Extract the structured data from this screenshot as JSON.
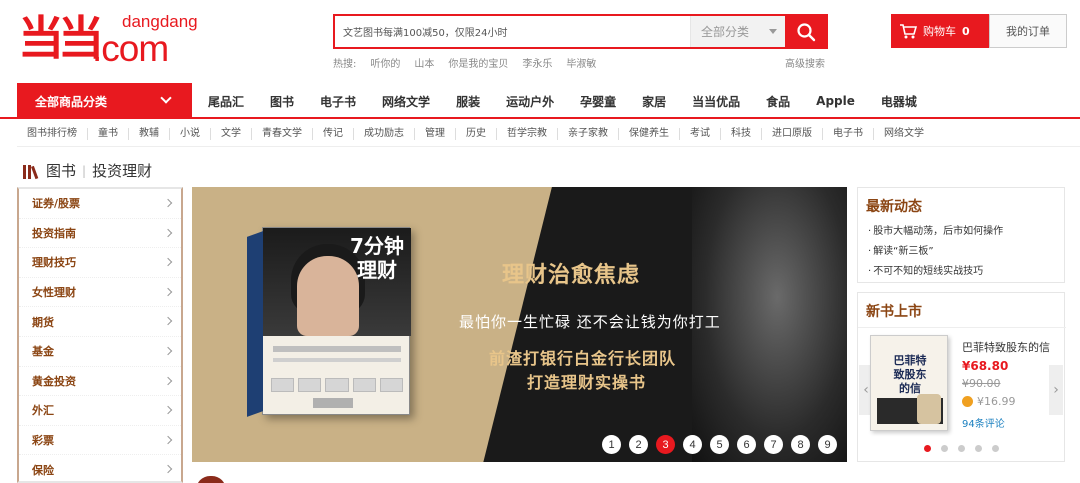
{
  "header": {
    "logo_cn": "当当",
    "logo_en_top": "dangdang",
    "logo_en": ".com",
    "search_value": "文艺图书每满100减50，仅限24小时",
    "search_category": "全部分类",
    "hot_searches": [
      "热搜:",
      "听你的",
      "山本",
      "你是我的宝贝",
      "李永乐",
      "毕淑敏"
    ],
    "advanced_search": "高级搜索",
    "cart_label": "购物车",
    "cart_count": "0",
    "orders_label": "我的订单"
  },
  "main_nav": {
    "all_categories": "全部商品分类",
    "items": [
      "尾品汇",
      "图书",
      "电子书",
      "网络文学",
      "服装",
      "运动户外",
      "孕婴童",
      "家居",
      "当当优品",
      "食品",
      "Apple",
      "电器城"
    ]
  },
  "sub_nav": [
    "图书排行榜",
    "童书",
    "教辅",
    "小说",
    "文学",
    "青春文学",
    "传记",
    "成功励志",
    "管理",
    "历史",
    "哲学宗教",
    "亲子家教",
    "保健养生",
    "考试",
    "科技",
    "进口原版",
    "电子书",
    "网络文学"
  ],
  "breadcrumb": {
    "root": "图书",
    "current": "投资理财"
  },
  "categories": [
    "证券/股票",
    "投资指南",
    "理财技巧",
    "女性理财",
    "期货",
    "基金",
    "黄金投资",
    "外汇",
    "彩票",
    "保险"
  ],
  "banner": {
    "book_title": "7分钟 理财",
    "line1": "理财治愈焦虑",
    "line2": "最怕你一生忙碌 还不会让钱为你打工",
    "line3": "前渣打银行白金行长团队",
    "line4": "打造理财实操书",
    "pages": [
      "1",
      "2",
      "3",
      "4",
      "5",
      "6",
      "7",
      "8",
      "9"
    ],
    "active_page": 3
  },
  "news": {
    "title": "最新动态",
    "items": [
      "股市大幅动荡，后市如何操作",
      "解读“新三板”",
      "不可不知的短线实战技巧"
    ]
  },
  "new_books": {
    "title": "新书上市",
    "cover_text": "巴菲特 致股东的信",
    "name": "巴菲特致股东的信",
    "price": "¥68.80",
    "old_price": "¥90.00",
    "ebook_price": "¥16.99",
    "reviews": "94条评论"
  },
  "colors": {
    "brand": "#e8191f",
    "category_text": "#8b4513",
    "banner_gold": "#c9b186",
    "banner_text": "#e8c58a"
  }
}
